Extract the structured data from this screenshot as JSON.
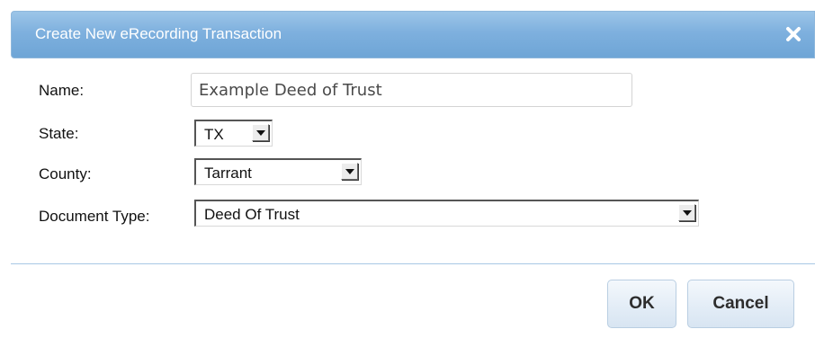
{
  "dialog": {
    "title": "Create New eRecording Transaction",
    "close_icon": "close-x-icon"
  },
  "form": {
    "name": {
      "label": "Name:",
      "value": "Example Deed of Trust"
    },
    "state": {
      "label": "State:",
      "selected": "TX"
    },
    "county": {
      "label": "County:",
      "selected": "Tarrant"
    },
    "document_type": {
      "label": "Document Type:",
      "selected": "Deed Of Trust"
    }
  },
  "buttons": {
    "ok_label": "OK",
    "cancel_label": "Cancel"
  },
  "colors": {
    "titlebar": "#7eb0de",
    "title_text": "#ffffff",
    "button_bg": "#e2ecf6",
    "divider": "#a8c8e4"
  }
}
